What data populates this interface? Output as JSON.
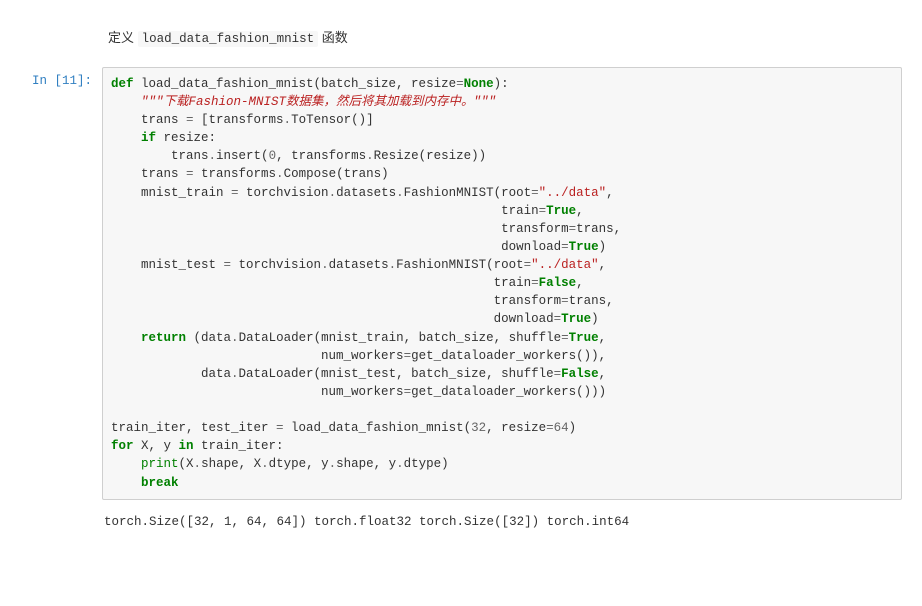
{
  "markdown": {
    "prefix": "定义 ",
    "code": "load_data_fashion_mnist",
    "suffix": " 函数"
  },
  "prompt": "In [11]:",
  "code": {
    "kw_def": "def",
    "fn_name": " load_data_fashion_mnist(batch_size, resize",
    "eq": "=",
    "none": "None",
    "close_sig": "):",
    "indent1": "    ",
    "docstring": "\"\"\"下载Fashion-MNIST数据集，然后将其加载到内存中。\"\"\"",
    "l3a": "    trans ",
    "l3b": " [transforms",
    "dot": ".",
    "l3c": "ToTensor()]",
    "kw_if": "if",
    "l4": " resize:",
    "l5a": "        trans",
    "l5b": "insert(",
    "zero": "0",
    "l5c": ", transforms",
    "l5d": "Resize(resize))",
    "l6a": "    trans ",
    "l6b": " transforms",
    "l6c": "Compose(trans)",
    "l7a": "    mnist_train ",
    "l7b": " torchvision",
    "l7c": "datasets",
    "l7d": "FashionMNIST(root",
    "str_data": "\"../data\"",
    "comma": ",",
    "l8pad": "                                                    ",
    "l8a": "train",
    "true": "True",
    "l9a": "transform",
    "l9b": "trans,",
    "l10a": "download",
    "rparen": ")",
    "l11a": "    mnist_test ",
    "l12pad": "                                                   ",
    "false": "False",
    "kw_return": "return",
    "l15a": " (data",
    "l15b": "DataLoader(mnist_train, batch_size, shuffle",
    "l16pad": "                            ",
    "l16a": "num_workers",
    "l16b": "get_dataloader_workers()),",
    "l17a": "            data",
    "l17b": "DataLoader(mnist_test, batch_size, shuffle",
    "l18b": "get_dataloader_workers()))",
    "blank": "",
    "l19a": "train_iter, test_iter ",
    "l19b": " load_data_fashion_mnist(",
    "n32": "32",
    "l19c": ", resize",
    "n64": "64",
    "kw_for": "for",
    "l20a": " X, y ",
    "kw_in": "in",
    "l20b": " train_iter:",
    "kw_print": "print",
    "l21a": "(X",
    "l21b": "shape, X",
    "l21c": "dtype, y",
    "l21d": "shape, y",
    "l21e": "dtype)",
    "kw_break": "break"
  },
  "output": "torch.Size([32, 1, 64, 64]) torch.float32 torch.Size([32]) torch.int64"
}
